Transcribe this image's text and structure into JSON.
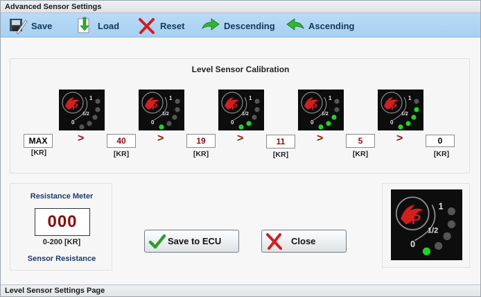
{
  "window": {
    "title": "Advanced Sensor Settings"
  },
  "toolbar": {
    "save_label": "Save",
    "load_label": "Load",
    "reset_label": "Reset",
    "descending_label": "Descending",
    "ascending_label": "Ascending"
  },
  "calibration": {
    "title": "Level Sensor Calibration",
    "separator": ">",
    "unit": "[KR]",
    "values": [
      "MAX",
      "40",
      "19",
      "11",
      "5",
      "0"
    ],
    "sensor_levels": [
      0,
      1,
      2,
      3,
      4
    ]
  },
  "sensor_label": {
    "one": "1",
    "half": "1/2",
    "zero": "0"
  },
  "resistance": {
    "title": "Resistance Meter",
    "value": "000",
    "range": "0-200 [KR]",
    "label": "Sensor Resistance"
  },
  "buttons": {
    "save_ecu_label": "Save to ECU",
    "close_label": "Close"
  },
  "status": {
    "text": "Level Sensor Settings Page"
  },
  "colors": {
    "toolbar_bg": "#a6d0f2",
    "led_on": "#22d22a",
    "led_off": "#555555",
    "logo_red": "#d41f1f",
    "value_red": "#8b0b0b",
    "heading_blue": "#1f3a68"
  }
}
